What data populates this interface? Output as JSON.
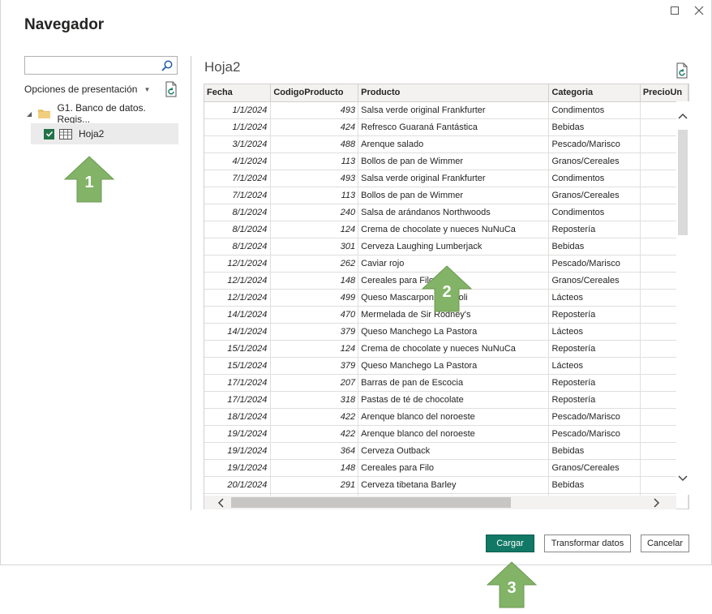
{
  "window": {
    "title": "Navegador"
  },
  "left_panel": {
    "search_placeholder": "",
    "display_options_label": "Opciones de presentación",
    "tree": {
      "folder_label": "G1. Banco de datos. Regis...",
      "item_label": "Hoja2",
      "item_checked": true
    }
  },
  "preview": {
    "title": "Hoja2",
    "columns": [
      "Fecha",
      "CodigoProducto",
      "Producto",
      "Categoria",
      "PrecioUn"
    ],
    "rows": [
      [
        "1/1/2024",
        "493",
        "Salsa verde original Frankfurter",
        "Condimentos",
        ""
      ],
      [
        "1/1/2024",
        "424",
        "Refresco Guaraná Fantástica",
        "Bebidas",
        ""
      ],
      [
        "3/1/2024",
        "488",
        "Arenque salado",
        "Pescado/Marisco",
        ""
      ],
      [
        "4/1/2024",
        "113",
        "Bollos de pan de Wimmer",
        "Granos/Cereales",
        ""
      ],
      [
        "7/1/2024",
        "493",
        "Salsa verde original Frankfurter",
        "Condimentos",
        ""
      ],
      [
        "7/1/2024",
        "113",
        "Bollos de pan de Wimmer",
        "Granos/Cereales",
        ""
      ],
      [
        "8/1/2024",
        "240",
        "Salsa de arándanos Northwoods",
        "Condimentos",
        ""
      ],
      [
        "8/1/2024",
        "124",
        "Crema de chocolate y nueces NuNuCa",
        "Repostería",
        ""
      ],
      [
        "8/1/2024",
        "301",
        "Cerveza Laughing Lumberjack",
        "Bebidas",
        ""
      ],
      [
        "12/1/2024",
        "262",
        "Caviar rojo",
        "Pescado/Marisco",
        ""
      ],
      [
        "12/1/2024",
        "148",
        "Cereales para Filo",
        "Granos/Cereales",
        ""
      ],
      [
        "12/1/2024",
        "499",
        "Queso Mascarpone Fabioli",
        "Lácteos",
        ""
      ],
      [
        "14/1/2024",
        "470",
        "Mermelada de Sir Rodney's",
        "Repostería",
        ""
      ],
      [
        "14/1/2024",
        "379",
        "Queso Manchego La Pastora",
        "Lácteos",
        ""
      ],
      [
        "15/1/2024",
        "124",
        "Crema de chocolate y nueces NuNuCa",
        "Repostería",
        ""
      ],
      [
        "15/1/2024",
        "379",
        "Queso Manchego La Pastora",
        "Lácteos",
        ""
      ],
      [
        "17/1/2024",
        "207",
        "Barras de pan de Escocia",
        "Repostería",
        ""
      ],
      [
        "17/1/2024",
        "318",
        "Pastas de té de chocolate",
        "Repostería",
        ""
      ],
      [
        "18/1/2024",
        "422",
        "Arenque blanco del noroeste",
        "Pescado/Marisco",
        ""
      ],
      [
        "19/1/2024",
        "422",
        "Arenque blanco del noroeste",
        "Pescado/Marisco",
        ""
      ],
      [
        "19/1/2024",
        "364",
        "Cerveza Outback",
        "Bebidas",
        ""
      ],
      [
        "19/1/2024",
        "148",
        "Cereales para Filo",
        "Granos/Cereales",
        ""
      ],
      [
        "20/1/2024",
        "291",
        "Cerveza tibetana Barley",
        "Bebidas",
        ""
      ],
      [
        "",
        "",
        "",
        "",
        ""
      ]
    ]
  },
  "buttons": {
    "load": "Cargar",
    "transform": "Transformar datos",
    "cancel": "Cancelar"
  },
  "markers": [
    "1",
    "2",
    "3"
  ],
  "colors": {
    "accent": "#117865",
    "marker": "#82b366",
    "checkbox": "#217346"
  }
}
